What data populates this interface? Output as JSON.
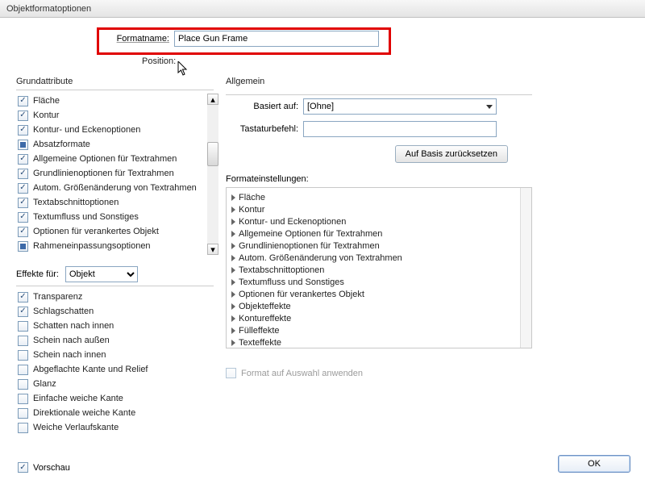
{
  "window": {
    "title": "Objektformatoptionen"
  },
  "header": {
    "formatname_label": "Formatname:",
    "formatname_value": "Place Gun Frame",
    "position_label": "Position:"
  },
  "left": {
    "grundattribute_title": "Grundattribute",
    "attrs": [
      {
        "label": "Fläche",
        "state": "tick"
      },
      {
        "label": "Kontur",
        "state": "tick"
      },
      {
        "label": "Kontur- und Eckenoptionen",
        "state": "tick"
      },
      {
        "label": "Absatzformate",
        "state": "square"
      },
      {
        "label": "Allgemeine Optionen für Textrahmen",
        "state": "tick"
      },
      {
        "label": "Grundlinienoptionen für Textrahmen",
        "state": "tick"
      },
      {
        "label": "Autom. Größenänderung von Textrahmen",
        "state": "tick"
      },
      {
        "label": "Textabschnittoptionen",
        "state": "tick"
      },
      {
        "label": "Textumfluss und Sonstiges",
        "state": "tick"
      },
      {
        "label": "Optionen für verankertes Objekt",
        "state": "tick"
      },
      {
        "label": "Rahmeneinpassungsoptionen",
        "state": "square"
      }
    ],
    "effects_for_label": "Effekte für:",
    "effects_for_value": "Objekt",
    "effects": [
      {
        "label": "Transparenz",
        "state": "tick"
      },
      {
        "label": "Schlagschatten",
        "state": "tick"
      },
      {
        "label": "Schatten nach innen",
        "state": "none"
      },
      {
        "label": "Schein nach außen",
        "state": "none"
      },
      {
        "label": "Schein nach innen",
        "state": "none"
      },
      {
        "label": "Abgeflachte Kante und Relief",
        "state": "none"
      },
      {
        "label": "Glanz",
        "state": "none"
      },
      {
        "label": "Einfache weiche Kante",
        "state": "none"
      },
      {
        "label": "Direktionale weiche Kante",
        "state": "none"
      },
      {
        "label": "Weiche Verlaufskante",
        "state": "none"
      }
    ]
  },
  "right": {
    "general_title": "Allgemein",
    "based_on_label": "Basiert auf:",
    "based_on_value": "[Ohne]",
    "shortcut_label": "Tastaturbefehl:",
    "shortcut_value": "",
    "reset_button": "Auf Basis zurücksetzen",
    "settings_title": "Formateinstellungen:",
    "tree": [
      "Fläche",
      "Kontur",
      "Kontur- und Eckenoptionen",
      "Allgemeine Optionen für Textrahmen",
      "Grundlinienoptionen für Textrahmen",
      "Autom. Größenänderung von Textrahmen",
      "Textabschnittoptionen",
      "Textumfluss und Sonstiges",
      "Optionen für verankertes Objekt",
      "Objekteffekte",
      "Kontureffekte",
      "Fülleffekte",
      "Texteffekte"
    ],
    "apply_label": "Format auf Auswahl anwenden"
  },
  "footer": {
    "preview_label": "Vorschau",
    "ok_label": "OK"
  }
}
